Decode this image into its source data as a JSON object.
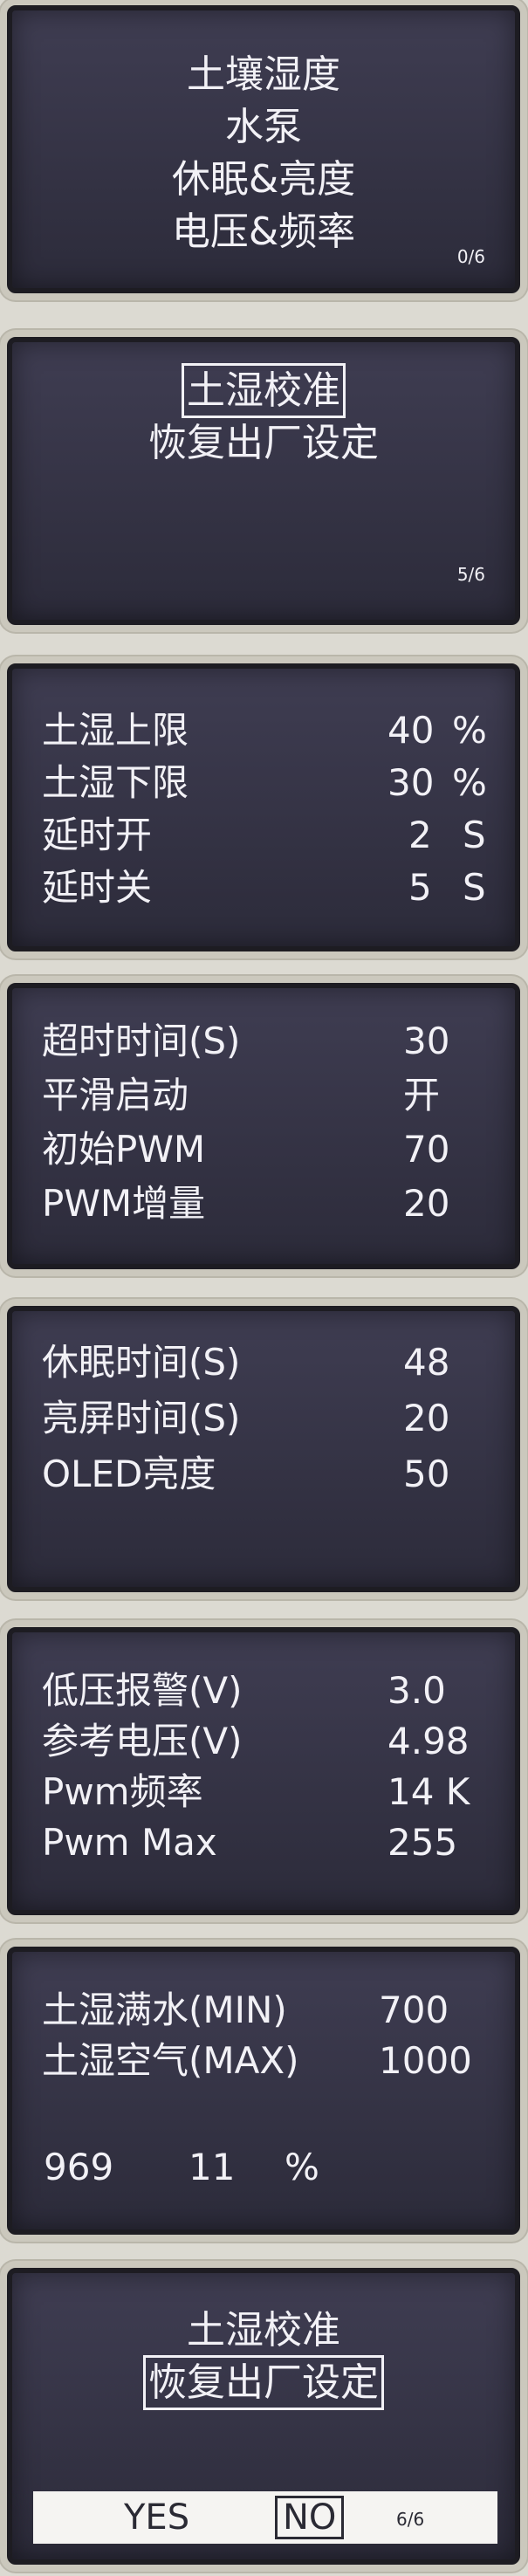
{
  "screens": [
    {
      "id": "main-menu",
      "lines": [
        "土壤湿度",
        "水泵",
        "休眠&亮度",
        "电压&频率"
      ],
      "page": "0/6"
    },
    {
      "id": "calib-menu",
      "lines": [
        "土湿校准",
        "恢复出厂设定"
      ],
      "selected": "土湿校准",
      "page": "5/6"
    },
    {
      "id": "soil-settings",
      "rows": [
        {
          "label": "土湿上限",
          "value": "40",
          "unit": "%"
        },
        {
          "label": "土湿下限",
          "value": "30",
          "unit": "%"
        },
        {
          "label": "延时开",
          "value": "2",
          "unit": "S"
        },
        {
          "label": "延时关",
          "value": "5",
          "unit": "S"
        }
      ]
    },
    {
      "id": "pump-settings",
      "rows": [
        {
          "label": "超时时间(S)",
          "value": "30"
        },
        {
          "label": "平滑启动",
          "value": "开"
        },
        {
          "label": "初始PWM",
          "value": "70"
        },
        {
          "label": "PWM增量",
          "value": "20"
        }
      ]
    },
    {
      "id": "sleep-settings",
      "rows": [
        {
          "label": "休眠时间(S)",
          "value": "48"
        },
        {
          "label": "亮屏时间(S)",
          "value": "20"
        },
        {
          "label": "OLED亮度",
          "value": "50"
        }
      ]
    },
    {
      "id": "voltage-settings",
      "rows": [
        {
          "label": "低压报警(V)",
          "value": "3.0"
        },
        {
          "label": "参考电压(V)",
          "value": "4.98"
        },
        {
          "label": "Pwm频率",
          "value": "14 K"
        },
        {
          "label": "Pwm Max",
          "value": "255"
        }
      ]
    },
    {
      "id": "calibration",
      "rows": [
        {
          "label": "土湿满水(MIN)",
          "value": "700"
        },
        {
          "label": "土湿空气(MAX)",
          "value": "1000"
        }
      ],
      "reading": {
        "raw": "969",
        "percent": "11",
        "unit": "%"
      }
    },
    {
      "id": "factory-reset-confirm",
      "lines": [
        "土湿校准",
        "恢复出厂设定"
      ],
      "selected": "恢复出厂设定",
      "yes": "YES",
      "no": "NO",
      "selected_option": "NO",
      "page": "6/6"
    }
  ]
}
